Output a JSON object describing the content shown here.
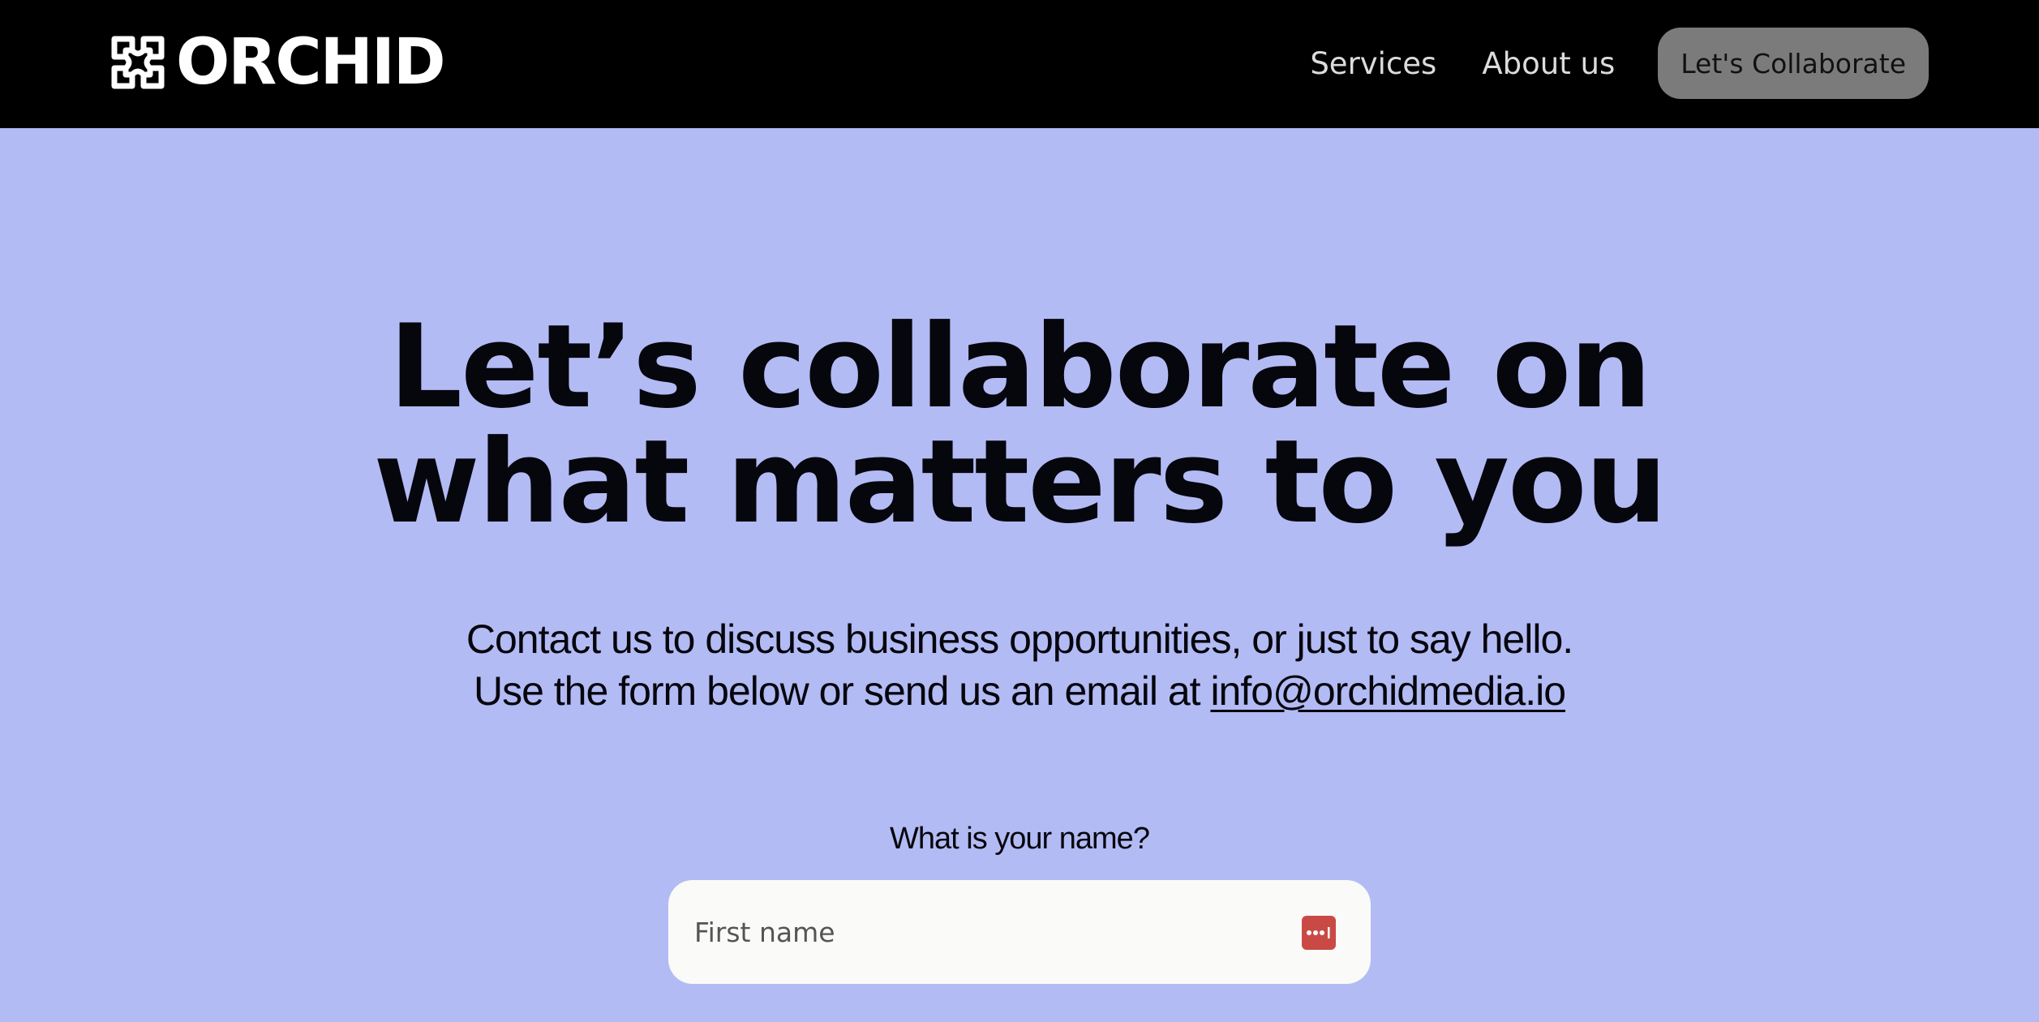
{
  "header": {
    "logo_text": "ORCHID",
    "nav": {
      "services": "Services",
      "about": "About us",
      "cta": "Let's Collaborate"
    }
  },
  "hero": {
    "title_line1": "Let’s collaborate on",
    "title_line2": "what matters to you",
    "subtitle_line1": "Contact us to discuss business opportunities, or just to say hello.",
    "subtitle_line2_prefix": "Use the form below or send us an email at ",
    "email": "info@orchidmedia.io"
  },
  "form": {
    "name_label": "What is your name?",
    "first_name_placeholder": "First name",
    "password_manager_icon": "password-manager-icon"
  },
  "colors": {
    "background": "#b3bbf4",
    "header": "#000000",
    "cta_button": "#7b7b7b",
    "field_bg": "#fafaf8",
    "icon_accent": "#c94a45"
  }
}
